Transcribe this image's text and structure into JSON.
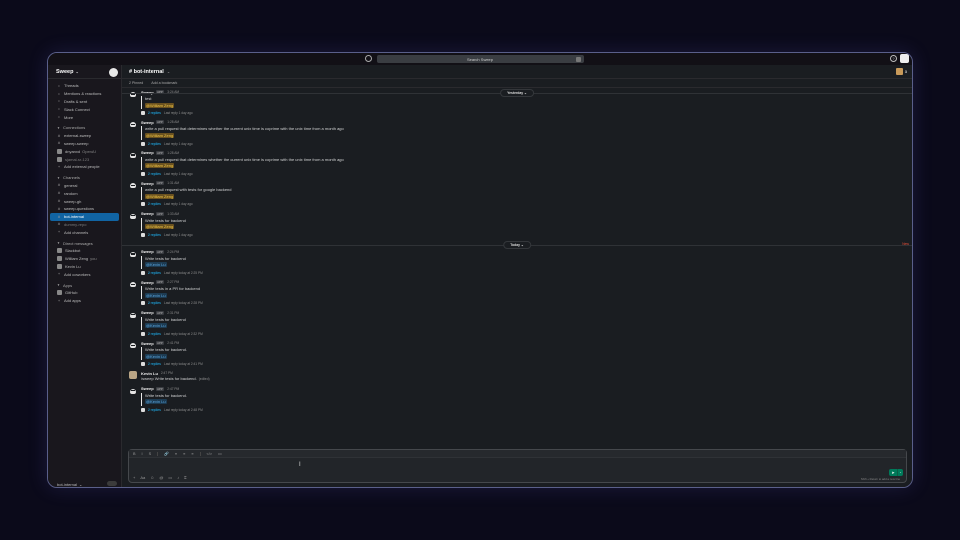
{
  "topbar": {
    "search_placeholder": "Search Sweep"
  },
  "sidebar": {
    "workspace": "Sweep",
    "nav": [
      {
        "label": "Threads",
        "icon": "threads-icon"
      },
      {
        "label": "Mentions & reactions",
        "icon": "at-icon"
      },
      {
        "label": "Drafts & sent",
        "icon": "send-icon"
      },
      {
        "label": "Slack Connect",
        "icon": "connect-icon"
      },
      {
        "label": "More",
        "icon": "more-icon"
      }
    ],
    "connections_header": "Connections",
    "connections": [
      {
        "label": "external-sweep",
        "icon": "#"
      },
      {
        "label": "sweep-sweep",
        "icon": "#"
      },
      {
        "label": "dnyanxd",
        "extra": "OpenAI"
      },
      {
        "label": "sjamal-sr-123",
        "dim": true
      }
    ],
    "add_external": "Add external people",
    "channels_header": "Channels",
    "channels": [
      "general",
      "random",
      "sweep-gh",
      "sweep-questions",
      "bot-internal",
      "dummy-repo"
    ],
    "active_channel": "bot-internal",
    "add_channels": "Add channels",
    "dms_header": "Direct messages",
    "dms": [
      {
        "label": "Slackbot",
        "you": ""
      },
      {
        "label": "William Zeng",
        "you": "you"
      },
      {
        "label": "Kevin Lu",
        "you": ""
      }
    ],
    "add_coworkers": "Add coworkers",
    "apps_header": "Apps",
    "apps": [
      "GitHub"
    ],
    "add_apps": "Add apps",
    "footer": "bot-internal"
  },
  "channel": {
    "name": "# bot-internal",
    "caret": "⌄",
    "member_count": "3",
    "bookmarks": [
      "2 Pinned",
      "Add a bookmark"
    ]
  },
  "feed": {
    "day_yesterday": "Yesterday ⌄",
    "day_today": "Today ⌄",
    "new_label": "New",
    "yesterday_messages": [
      {
        "name": "Sweep",
        "time": "3:24 AM",
        "lines": [
          "test"
        ],
        "mention": "@William Zeng",
        "replies": "2 replies",
        "last": "Last reply 1 day ago"
      },
      {
        "name": "Sweep",
        "time": "1:28 AM",
        "lines": [
          "write a pull request that determines whether the current unix time is coprime with the unix time from a month ago"
        ],
        "mention": "@William Zeng",
        "replies": "2 replies",
        "last": "Last reply 1 day ago"
      },
      {
        "name": "Sweep",
        "time": "1:28 AM",
        "lines": [
          "write a pull request that determines whether the current unix time is coprime with the unix time from a month ago"
        ],
        "mention": "@William Zeng",
        "replies": "2 replies",
        "last": "Last reply 1 day ago"
      },
      {
        "name": "Sweep",
        "time": "1:31 AM",
        "lines": [
          "write a pull request with tests for google backend"
        ],
        "mention": "@William Zeng",
        "replies": "2 replies",
        "last": "Last reply 1 day ago"
      },
      {
        "name": "Sweep",
        "time": "1:33 AM",
        "lines": [
          "Write tests for backend"
        ],
        "mention": "@William Zeng",
        "replies": "2 replies",
        "last": "Last reply 1 day ago"
      }
    ],
    "today_messages": [
      {
        "name": "Sweep",
        "time": "2:24 PM",
        "lines": [
          "Write tests for backend"
        ],
        "mention": "@Kevin Lu",
        "replies": "2 replies",
        "last": "Last reply today at 2:25 PM"
      },
      {
        "name": "Sweep",
        "time": "2:27 PM",
        "lines": [
          "Write tests in a PR for backend"
        ],
        "mention": "@Kevin Lu",
        "replies": "2 replies",
        "last": "Last reply today at 2:28 PM"
      },
      {
        "name": "Sweep",
        "time": "2:31 PM",
        "lines": [
          "Write tests for backend"
        ],
        "mention": "@Kevin Lu",
        "replies": "2 replies",
        "last": "Last reply today at 2:32 PM"
      },
      {
        "name": "Sweep",
        "time": "2:41 PM",
        "lines": [
          "Write tests for backend."
        ],
        "mention": "@Kevin Lu",
        "replies": "2 replies",
        "last": "Last reply today at 2:41 PM"
      }
    ],
    "human_message": {
      "name": "Kevin Lu",
      "time": "2:47 PM",
      "text": "/sweep Write tests for backend.",
      "edited": "(edited)"
    },
    "last_bot": {
      "name": "Sweep",
      "time": "2:47 PM",
      "lines": [
        "Write tests for backend."
      ],
      "mention": "@Kevin Lu",
      "replies": "2 replies",
      "last": "Last reply today at 2:48 PM"
    },
    "app_badge": "APP"
  },
  "composer": {
    "format_icons": [
      "B",
      "I",
      "S",
      "🔗",
      "≡",
      "≡",
      "≡",
      "</>",
      "▭"
    ],
    "action_icons": [
      "+",
      "Aa",
      "☺",
      "@",
      "▭",
      "♪",
      "⌗"
    ],
    "send": "➤",
    "send_dd": "⌄",
    "hint": "Shift + Return to add a new line"
  }
}
